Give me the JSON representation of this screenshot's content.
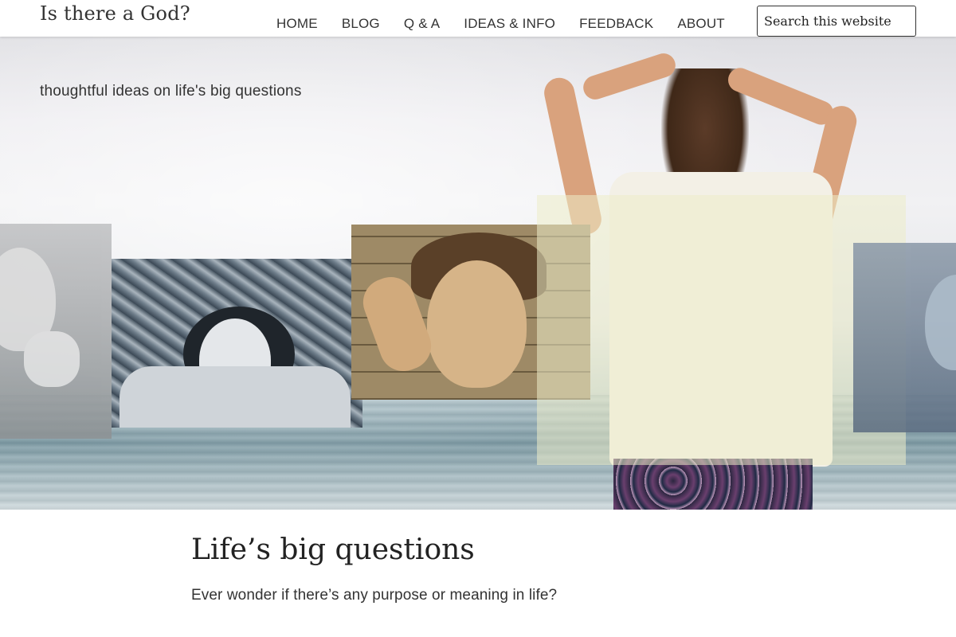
{
  "header": {
    "site_title": "Is there a God?",
    "search": {
      "placeholder": "Search this website"
    }
  },
  "nav": {
    "items": [
      {
        "label": "HOME"
      },
      {
        "label": "BLOG"
      },
      {
        "label": "Q & A"
      },
      {
        "label": "IDEAS & INFO"
      },
      {
        "label": "FEEDBACK"
      },
      {
        "label": "ABOUT"
      }
    ]
  },
  "hero": {
    "tagline": "thoughtful ideas on life's big questions"
  },
  "content": {
    "title": "Life’s big questions",
    "intro": "Ever wonder if there’s any purpose or meaning in life?"
  },
  "colors": {
    "text": "#333333",
    "background": "#ffffff",
    "sea": "#7e99a3",
    "overlay": "#ececc8"
  }
}
